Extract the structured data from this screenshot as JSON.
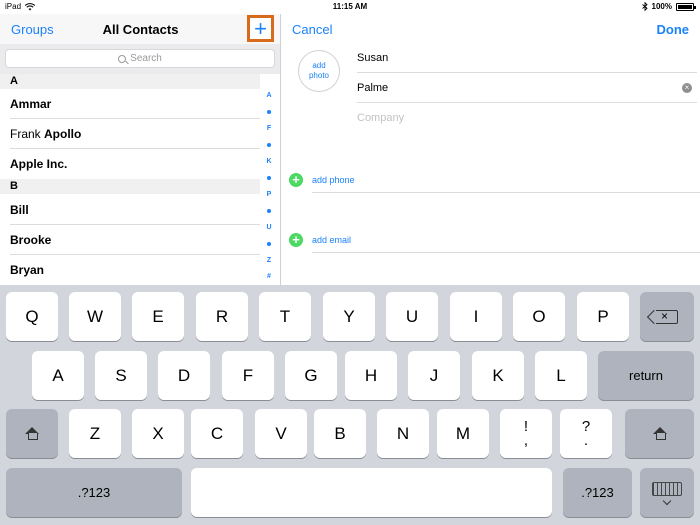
{
  "status_bar": {
    "device": "iPad",
    "time": "11:15 AM",
    "battery": "100%",
    "battery_level": 1.0,
    "icons": [
      "wifi-icon",
      "bluetooth-icon",
      "battery-icon"
    ]
  },
  "left_nav": {
    "groups_label": "Groups",
    "title": "All Contacts",
    "add_label": "+"
  },
  "search": {
    "placeholder": "Search"
  },
  "contacts": {
    "section_a": "A",
    "section_b": "B",
    "rows": [
      {
        "first": "Ammar",
        "last": ""
      },
      {
        "first": "Frank ",
        "last": "Apollo"
      },
      {
        "first": "Apple Inc.",
        "last": ""
      },
      {
        "first": "Bill",
        "last": ""
      },
      {
        "first": "Brooke",
        "last": ""
      },
      {
        "first": "Bryan",
        "last": ""
      }
    ]
  },
  "index_letters": [
    "A",
    "•",
    "F",
    "•",
    "K",
    "•",
    "P",
    "•",
    "U",
    "•",
    "Z",
    "#"
  ],
  "right_nav": {
    "cancel_label": "Cancel",
    "done_label": "Done"
  },
  "editor": {
    "add_photo": "add photo",
    "first_name": "Susan",
    "last_name": "Palme",
    "company_placeholder": "Company",
    "add_phone": "add phone",
    "add_email": "add email"
  },
  "keyboard": {
    "row1": [
      "Q",
      "W",
      "E",
      "R",
      "T",
      "Y",
      "U",
      "I",
      "O",
      "P"
    ],
    "row2": [
      "A",
      "S",
      "D",
      "F",
      "G",
      "H",
      "J",
      "K",
      "L"
    ],
    "return_label": "return",
    "row3": [
      "Z",
      "X",
      "C",
      "V",
      "B",
      "N",
      "M"
    ],
    "punct1_top": "!",
    "punct1_bottom": ",",
    "punct2_top": "?",
    "punct2_bottom": ".",
    "numbers_label": ".?123"
  },
  "colors": {
    "accent": "#1a82fb",
    "highlight": "#d86a1b",
    "add_green": "#4cd964",
    "keyboard_bg": "#d2d5db"
  }
}
